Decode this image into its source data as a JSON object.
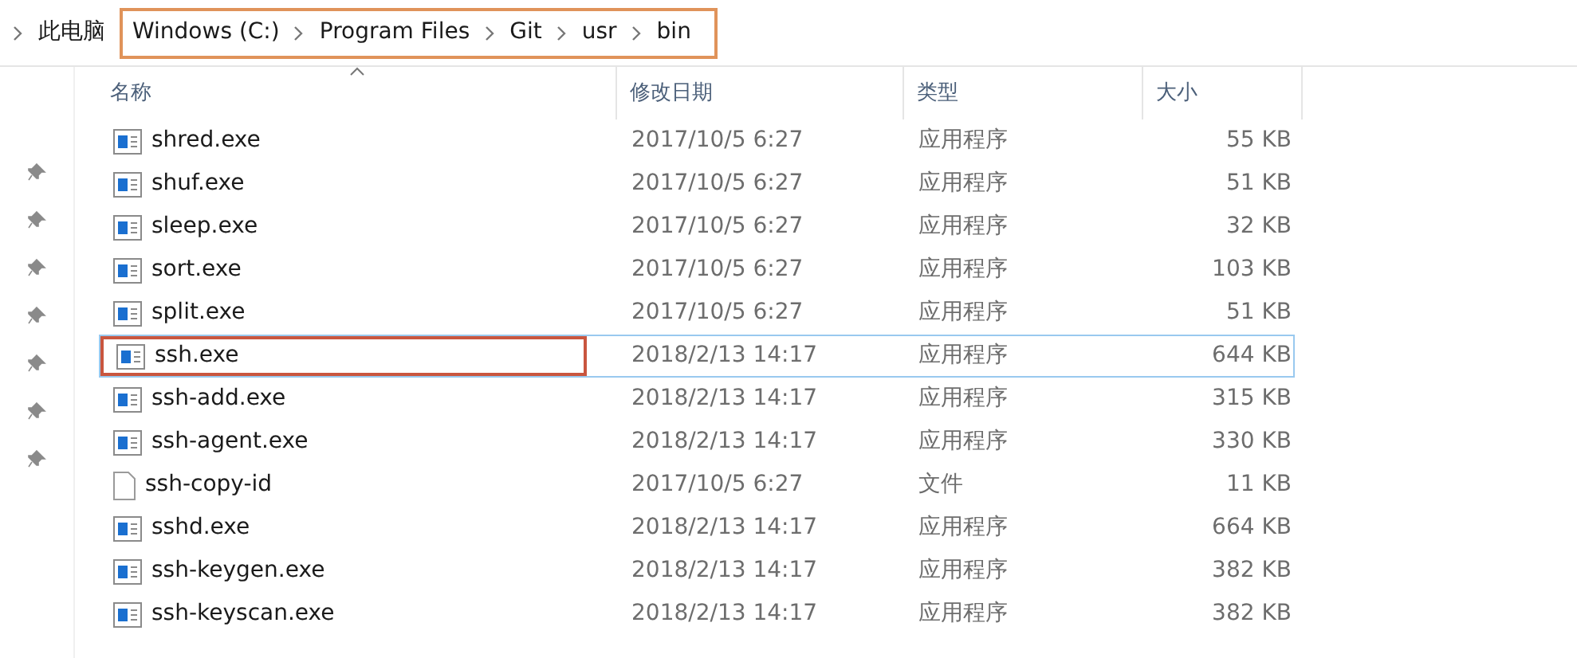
{
  "breadcrumb": {
    "root": "此电脑",
    "path": [
      "Windows (C:)",
      "Program Files",
      "Git",
      "usr",
      "bin"
    ]
  },
  "sidebar": {
    "pinned_count_items": [
      {
        "pinned": true
      },
      {
        "pinned": true
      },
      {
        "pinned": true
      },
      {
        "pinned": true
      },
      {
        "pinned": true
      },
      {
        "pinned": true
      },
      {
        "pinned": true
      }
    ]
  },
  "table": {
    "columns": [
      {
        "label": "名称",
        "sorted": true
      },
      {
        "label": "修改日期",
        "sorted": false
      },
      {
        "label": "类型",
        "sorted": false
      },
      {
        "label": "大小",
        "sorted": false
      }
    ],
    "rows": [
      {
        "name": "shred.exe",
        "kind": "exe",
        "date": "2017/10/5 6:27",
        "type": "应用程序",
        "size": "55 KB",
        "focused": false
      },
      {
        "name": "shuf.exe",
        "kind": "exe",
        "date": "2017/10/5 6:27",
        "type": "应用程序",
        "size": "51 KB",
        "focused": false
      },
      {
        "name": "sleep.exe",
        "kind": "exe",
        "date": "2017/10/5 6:27",
        "type": "应用程序",
        "size": "32 KB",
        "focused": false
      },
      {
        "name": "sort.exe",
        "kind": "exe",
        "date": "2017/10/5 6:27",
        "type": "应用程序",
        "size": "103 KB",
        "focused": false
      },
      {
        "name": "split.exe",
        "kind": "exe",
        "date": "2017/10/5 6:27",
        "type": "应用程序",
        "size": "51 KB",
        "focused": false
      },
      {
        "name": "ssh.exe",
        "kind": "exe",
        "date": "2018/2/13 14:17",
        "type": "应用程序",
        "size": "644 KB",
        "focused": true
      },
      {
        "name": "ssh-add.exe",
        "kind": "exe",
        "date": "2018/2/13 14:17",
        "type": "应用程序",
        "size": "315 KB",
        "focused": false
      },
      {
        "name": "ssh-agent.exe",
        "kind": "exe",
        "date": "2018/2/13 14:17",
        "type": "应用程序",
        "size": "330 KB",
        "focused": false
      },
      {
        "name": "ssh-copy-id",
        "kind": "file",
        "date": "2017/10/5 6:27",
        "type": "文件",
        "size": "11 KB",
        "focused": false
      },
      {
        "name": "sshd.exe",
        "kind": "exe",
        "date": "2018/2/13 14:17",
        "type": "应用程序",
        "size": "664 KB",
        "focused": false
      },
      {
        "name": "ssh-keygen.exe",
        "kind": "exe",
        "date": "2018/2/13 14:17",
        "type": "应用程序",
        "size": "382 KB",
        "focused": false
      },
      {
        "name": "ssh-keyscan.exe",
        "kind": "exe",
        "date": "2018/2/13 14:17",
        "type": "应用程序",
        "size": "382 KB",
        "focused": false
      }
    ]
  }
}
